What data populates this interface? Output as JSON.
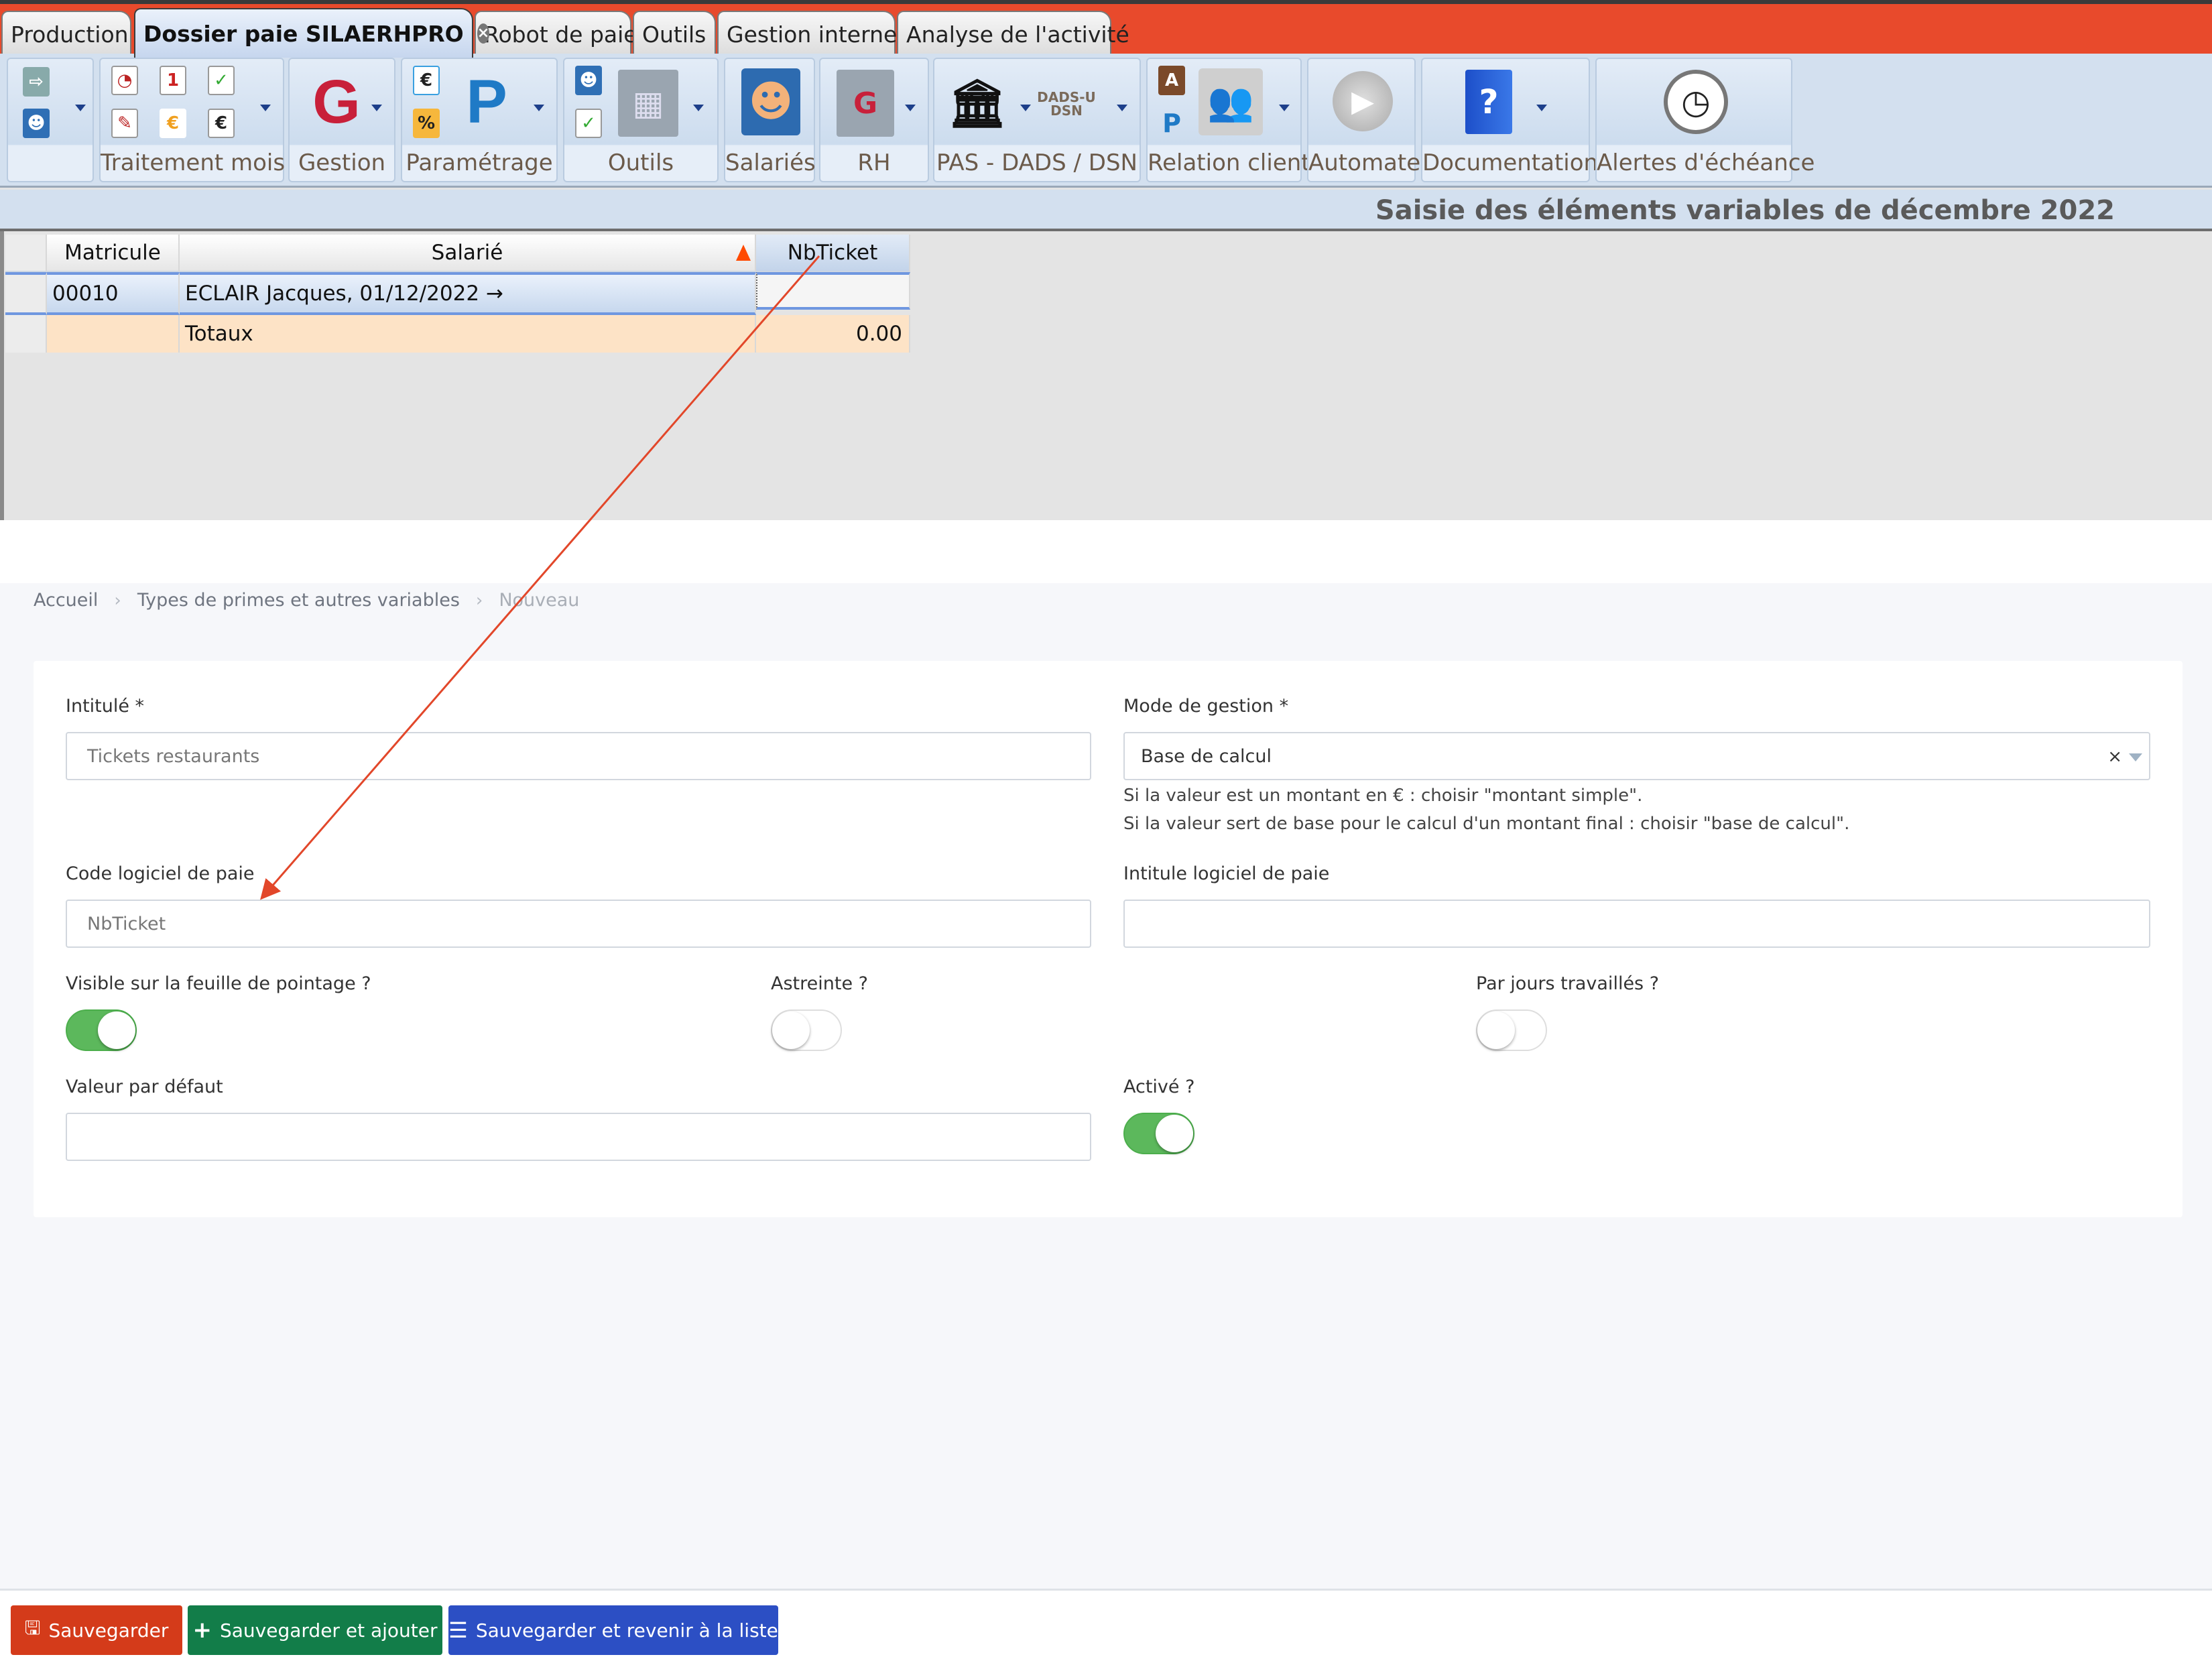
{
  "app": {
    "tabs": [
      {
        "label": "Production",
        "active": false
      },
      {
        "label": "Dossier paie SILAERHPRO",
        "active": true,
        "closable": true
      },
      {
        "label": "Robot de paie",
        "active": false
      },
      {
        "label": "Outils",
        "active": false
      },
      {
        "label": "Gestion interne",
        "active": false
      },
      {
        "label": "Analyse de l'activité",
        "active": false
      }
    ],
    "ribbon_groups": [
      {
        "label": "",
        "icons": [
          "import-employees-icon",
          "import-employee-icon"
        ],
        "dropdown": true
      },
      {
        "label": "Traitement mois",
        "icons": [
          "clock-edit-icon",
          "calendar-edit-icon",
          "calendar-check-icon",
          "document-edit-icon",
          "euro-edit-icon",
          "euro-check-icon"
        ],
        "dropdown": true
      },
      {
        "label": "Gestion",
        "icons": [
          "gestion-g-icon"
        ],
        "dropdown": true
      },
      {
        "label": "Paramétrage",
        "icons": [
          "euro-check-icon",
          "percent-check-icon",
          "parametrage-p-icon"
        ],
        "dropdown": true
      },
      {
        "label": "Outils",
        "icons": [
          "employee-s-icon",
          "calendar-check-icon",
          "building-tools-icon"
        ],
        "dropdown": true
      },
      {
        "label": "Salariés",
        "icons": [
          "employee-icon"
        ],
        "dropdown": false
      },
      {
        "label": "RH",
        "icons": [
          "building-g-icon"
        ],
        "dropdown": true
      },
      {
        "label": "PAS - DADS / DSN",
        "icons": [
          "government-building-icon",
          "dads-dsn-icon"
        ],
        "dropdown": true,
        "dads_text": "DADS-U DSN"
      },
      {
        "label": "Relation client",
        "icons": [
          "contact-card-icon",
          "p-icon",
          "clients-icon"
        ],
        "dropdown": true
      },
      {
        "label": "Automate",
        "icons": [
          "play-icon"
        ],
        "dropdown": false
      },
      {
        "label": "Documentation",
        "icons": [
          "help-book-icon"
        ],
        "dropdown": true
      },
      {
        "label": "Alertes d'échéance",
        "icons": [
          "stopwatch-icon"
        ],
        "dropdown": false
      }
    ],
    "page_title": "Saisie des éléments variables de décembre 2022",
    "grid": {
      "columns": [
        "Matricule",
        "Salarié",
        "NbTicket"
      ],
      "sort_column": "Salarié",
      "rows": [
        {
          "matricule": "00010",
          "salarie": "ECLAIR Jacques, 01/12/2022 →",
          "nbticket": ""
        }
      ],
      "totals": {
        "label": "Totaux",
        "nbticket": "0.00"
      }
    }
  },
  "web": {
    "breadcrumb": [
      {
        "label": "Accueil"
      },
      {
        "label": "Types de primes et autres variables"
      },
      {
        "label": "Nouveau"
      }
    ],
    "form": {
      "intitule": {
        "label": "Intitulé *",
        "placeholder": "Tickets restaurants",
        "value": ""
      },
      "mode_gestion": {
        "label": "Mode de gestion *",
        "value": "Base de calcul",
        "clear": "×",
        "help": [
          "Si la valeur est un montant en € : choisir \"montant simple\".",
          "Si la valeur sert de base pour le calcul d'un montant final : choisir \"base de calcul\"."
        ]
      },
      "code_logiciel": {
        "label": "Code logiciel de paie",
        "placeholder": "NbTicket",
        "value": ""
      },
      "intitule_logiciel": {
        "label": "Intitule logiciel de paie",
        "value": ""
      },
      "visible_pointage": {
        "label": "Visible sur la feuille de pointage ?",
        "on": true
      },
      "astreinte": {
        "label": "Astreinte ?",
        "on": false
      },
      "par_jours": {
        "label": "Par jours travaillés ?",
        "on": false
      },
      "valeur_defaut": {
        "label": "Valeur par défaut",
        "value": ""
      },
      "active": {
        "label": "Activé ?",
        "on": true
      }
    },
    "buttons": {
      "save": "Sauvegarder",
      "save_add": "Sauvegarder et ajouter",
      "save_list": "Sauvegarder et revenir à la liste"
    }
  },
  "colors": {
    "tabbar": "#e84a2c",
    "annotation_arrow": "#e2472a",
    "toggle_on": "#5cb85c",
    "btn_save": "#d43b1a",
    "btn_save_add": "#127d49",
    "btn_save_list": "#2c4fc4"
  }
}
